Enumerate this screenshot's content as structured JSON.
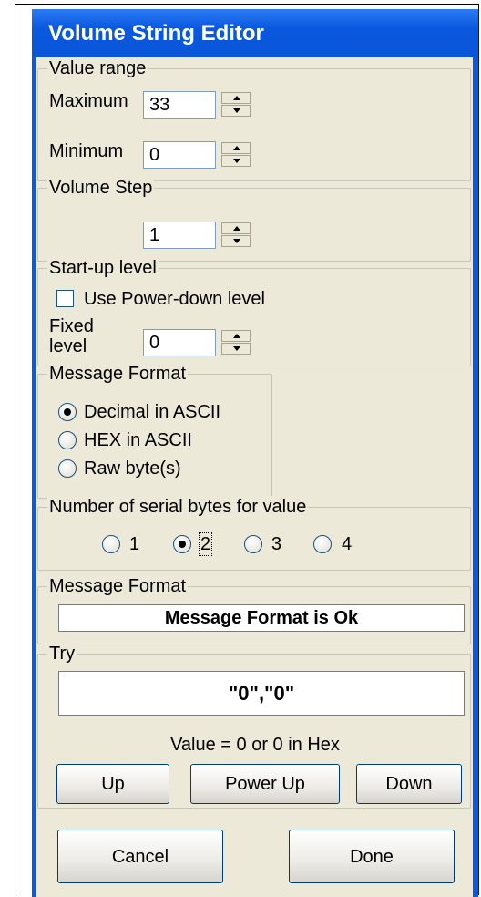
{
  "window": {
    "title": "Volume String Editor"
  },
  "value_range": {
    "legend": "Value range",
    "maximum_label": "Maximum",
    "maximum_value": "33",
    "minimum_label": "Minimum",
    "minimum_value": "0"
  },
  "volume_step": {
    "legend": "Volume Step",
    "value": "1"
  },
  "startup_level": {
    "legend": "Start-up level",
    "use_powerdown_label": "Use Power-down level",
    "use_powerdown_checked": false,
    "fixed_label_line1": "Fixed",
    "fixed_label_line2": "level",
    "fixed_value": "0"
  },
  "message_format": {
    "legend": "Message Format",
    "options": [
      "Decimal in ASCII",
      "HEX in ASCII",
      "Raw byte(s)"
    ],
    "selected": "Decimal in ASCII"
  },
  "serial_bytes": {
    "legend": "Number of serial bytes for value",
    "options": [
      "1",
      "2",
      "3",
      "4"
    ],
    "selected": "2"
  },
  "message_status": {
    "legend": "Message Format",
    "text": "Message Format is Ok"
  },
  "try": {
    "legend": "Try",
    "output": "\"0\",\"0\"",
    "value_text": "Value = 0 or 0 in Hex",
    "up_label": "Up",
    "power_up_label": "Power Up",
    "down_label": "Down"
  },
  "footer": {
    "cancel_label": "Cancel",
    "done_label": "Done"
  },
  "colors": {
    "title_bar": "#0958df",
    "face": "#ece9d8",
    "button_border": "#003c74"
  }
}
